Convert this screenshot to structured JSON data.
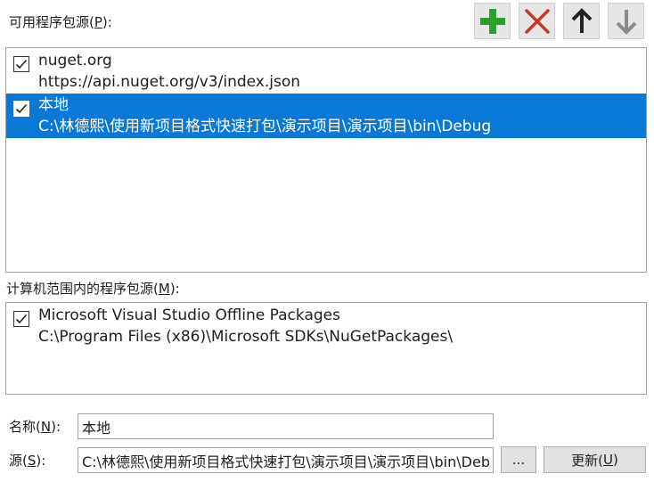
{
  "available": {
    "label_text": "可用程序包源(",
    "label_key": "P",
    "label_end": "):",
    "items": [
      {
        "name": "nuget.org",
        "source": "https://api.nuget.org/v3/index.json",
        "checked": true,
        "selected": false
      },
      {
        "name": "本地",
        "source": "C:\\林德熙\\使用新项目格式快速打包\\演示项目\\演示项目\\bin\\Debug",
        "checked": true,
        "selected": true
      }
    ]
  },
  "toolbar": {
    "add_icon": "plus-icon",
    "remove_icon": "x-icon",
    "move_up_icon": "arrow-up-icon",
    "move_down_icon": "arrow-down-icon",
    "add_color": "#2e9e2e",
    "remove_color": "#c0392b"
  },
  "machine": {
    "label_text": "计算机范围内的程序包源(",
    "label_key": "M",
    "label_end": "):",
    "items": [
      {
        "name": "Microsoft Visual Studio Offline Packages",
        "source": "C:\\Program Files (x86)\\Microsoft SDKs\\NuGetPackages\\",
        "checked": true
      }
    ]
  },
  "form": {
    "name_label_text": "名称(",
    "name_label_key": "N",
    "name_label_end": "):",
    "name_value": "本地",
    "source_label_text": "源(",
    "source_label_key": "S",
    "source_label_end": "):",
    "source_value": "C:\\林德熙\\使用新项目格式快速打包\\演示项目\\演示项目\\bin\\Debug",
    "browse_label": "...",
    "update_label_text": "更新(",
    "update_label_key": "U",
    "update_label_end": ")"
  },
  "colors": {
    "selection": "#0a78d6",
    "border": "#a3a3a3"
  }
}
